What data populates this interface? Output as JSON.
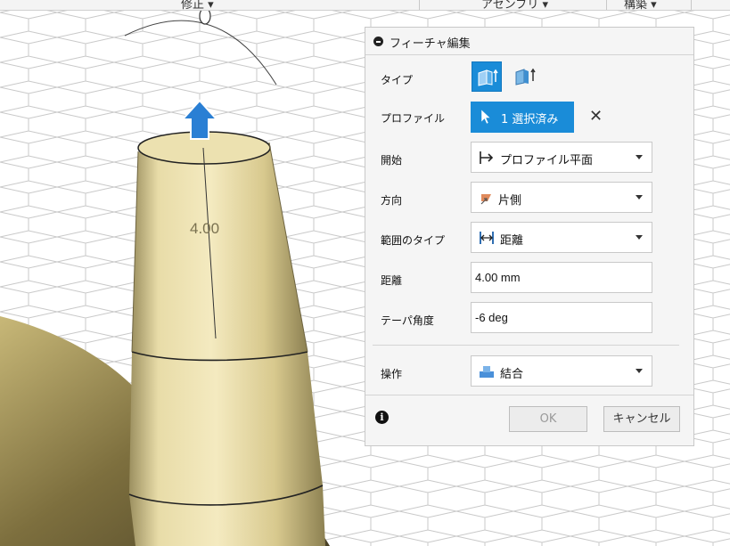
{
  "menubar": {
    "items": [
      {
        "label": "修正 ▾"
      },
      {
        "label": "アセンブリ ▾"
      },
      {
        "label": "構築 ▾"
      }
    ]
  },
  "viewport": {
    "dimension_label": "4.00"
  },
  "panel": {
    "title": "フィーチャ編集",
    "rows": {
      "type": {
        "label": "タイプ"
      },
      "profile": {
        "label": "プロファイル",
        "button": "1 選択済み",
        "clear": "✕"
      },
      "start": {
        "label": "開始",
        "value": "プロファイル平面"
      },
      "direction": {
        "label": "方向",
        "value": "片側"
      },
      "extent_type": {
        "label": "範囲のタイプ",
        "value": "距離"
      },
      "distance": {
        "label": "距離",
        "value": "4.00 mm"
      },
      "taper": {
        "label": "テーパ角度",
        "value": "-6 deg"
      },
      "operation": {
        "label": "操作",
        "value": "結合"
      }
    },
    "footer": {
      "info": "i",
      "ok": "OK",
      "cancel": "キャンセル"
    }
  },
  "colors": {
    "accent": "#1a8cd8",
    "body": "#e3d39a",
    "operation_icon": "#4a90d9",
    "direction_icon": "#e08a5c"
  }
}
